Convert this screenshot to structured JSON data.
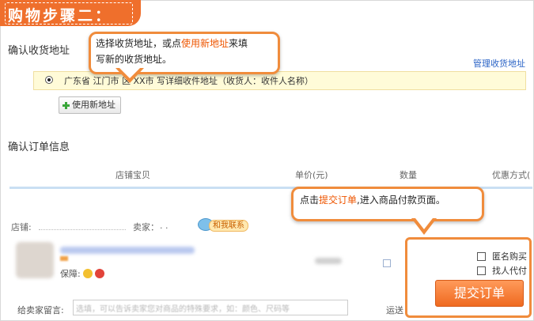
{
  "banner": {
    "title": "购物步骤二："
  },
  "address_section": {
    "title": "确认收货地址",
    "manage_link": "管理收货地址",
    "address_line": "广东省  江门市  区  XX市  写详细收件地址（收货人：收件人名称）",
    "new_address_button": "使用新地址"
  },
  "tip_address": {
    "part1": "选择收货地址，或点",
    "highlight": "使用新地址",
    "part2": "来填",
    "line2": "写新的收货地址。"
  },
  "order_section": {
    "title": "确认订单信息",
    "columns": [
      "店铺宝贝",
      "单价(元)",
      "数量",
      "优惠方式("
    ]
  },
  "tip_submit": {
    "part1": "点击",
    "highlight": "提交订单",
    "part2": ",进入商品付款页面。"
  },
  "store_row": {
    "store_label": "店铺:",
    "seller_label": "卖家：",
    "contact_label": "和我联系"
  },
  "item": {
    "guarantee_label": "保障:"
  },
  "message_row": {
    "label": "给卖家留言:",
    "placeholder": "选填，可以告诉卖家您对商品的特殊要求，如：颜色、尺码等"
  },
  "shipping_label": "运送",
  "options": {
    "anonymous": "匿名购买",
    "proxy_pay": "找人代付"
  },
  "submit_button": "提交订单",
  "colors": {
    "accent": "#ef6f2c",
    "link": "#2a63c6",
    "highlight": "#ee5500"
  }
}
